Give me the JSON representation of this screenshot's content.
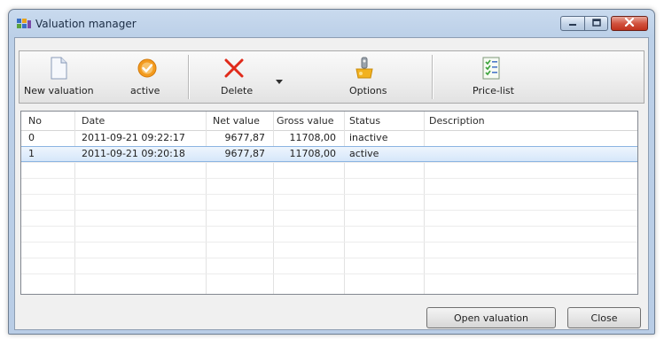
{
  "window": {
    "title": "Valuation manager"
  },
  "toolbar": {
    "new_valuation": "New valuation",
    "active": "active",
    "delete": "Delete",
    "options": "Options",
    "price_list": "Price-list"
  },
  "table": {
    "columns": [
      "No",
      "Date",
      "Net value",
      "Gross value",
      "Status",
      "Description"
    ],
    "rows": [
      {
        "no": "0",
        "date": "2011-09-21 09:22:17",
        "net": "9677,87",
        "gross": "11708,00",
        "status": "inactive",
        "description": ""
      },
      {
        "no": "1",
        "date": "2011-09-21 09:20:18",
        "net": "9677,87",
        "gross": "11708,00",
        "status": "active",
        "description": ""
      }
    ],
    "selected_row": 1
  },
  "buttons": {
    "open_valuation": "Open valuation",
    "close": "Close"
  },
  "colors": {
    "selection": "#d6e7fa",
    "close_button": "#c0321c",
    "active_icon": "#f39a1d",
    "delete_icon": "#e02a1a"
  }
}
